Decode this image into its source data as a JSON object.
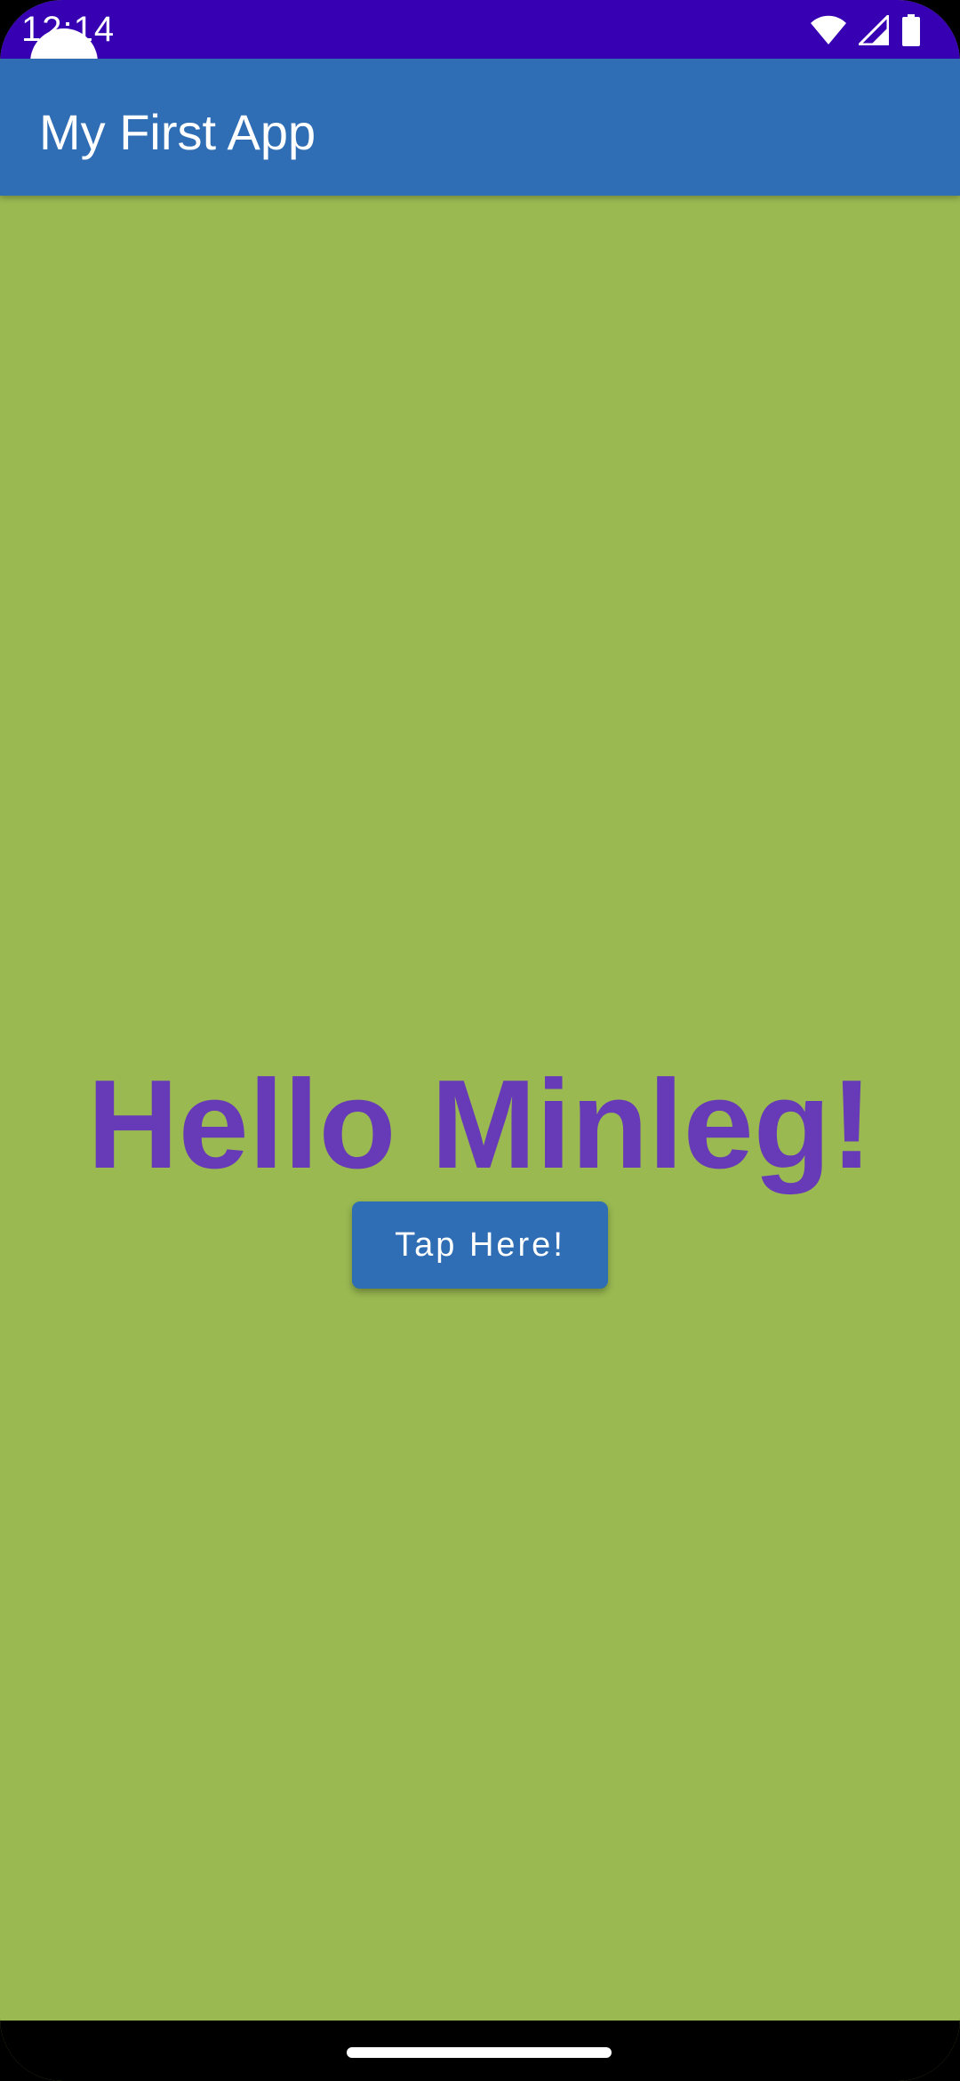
{
  "status_bar": {
    "time": "12:14",
    "icons": [
      "wifi-icon",
      "cell-signal-icon",
      "battery-icon"
    ],
    "color": "#3700B3"
  },
  "app_bar": {
    "title": "My First App",
    "color": "#2F6EB5"
  },
  "main": {
    "greeting": "Hello Minleg!",
    "greeting_color": "#673AB7",
    "button_label": "Tap Here!",
    "background": "#9AB951"
  },
  "nav_bar": {
    "icons": [
      "home-indicator"
    ]
  }
}
